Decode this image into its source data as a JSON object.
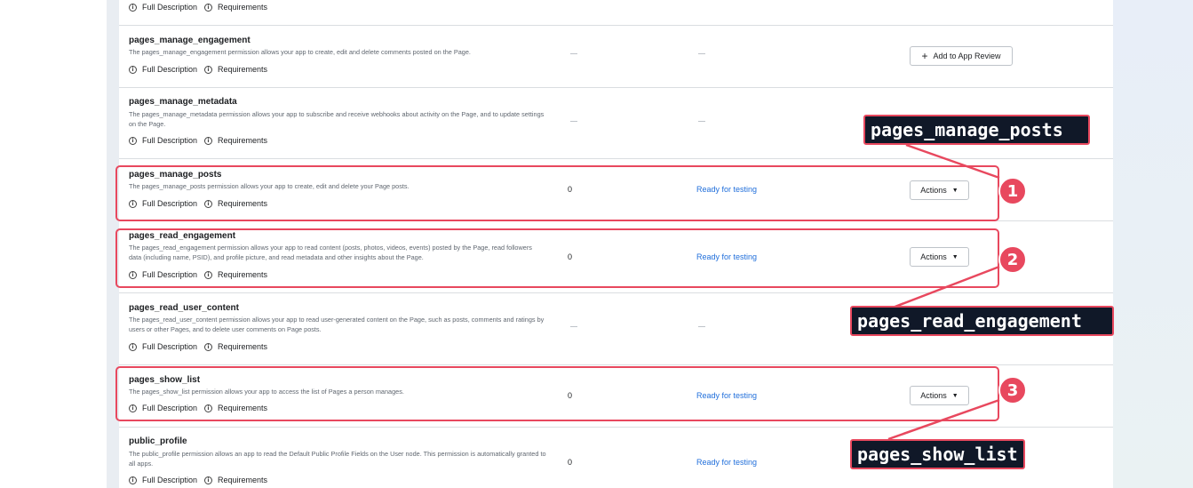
{
  "links": {
    "full_description": "Full Description",
    "requirements": "Requirements",
    "info_glyph": "i"
  },
  "rows": [
    {
      "name": "",
      "desc": ""
    },
    {
      "name": "pages_manage_engagement",
      "desc": "The pages_manage_engagement permission allows your app to create, edit and delete comments posted on the Page.",
      "button": "Add to App Review"
    },
    {
      "name": "pages_manage_metadata",
      "desc": "The pages_manage_metadata permission allows your app to subscribe and receive webhooks about activity on the Page, and to update settings on the Page."
    },
    {
      "name": "pages_manage_posts",
      "desc": "The pages_manage_posts permission allows your app to create, edit and delete your Page posts.",
      "count": "0",
      "status": "Ready for testing",
      "button": "Actions"
    },
    {
      "name": "pages_read_engagement",
      "desc": "The pages_read_engagement permission allows your app to read content (posts, photos, videos, events) posted by the Page, read followers data (including name, PSID), and profile picture, and read metadata and other insights about the Page.",
      "count": "0",
      "status": "Ready for testing",
      "button": "Actions"
    },
    {
      "name": "pages_read_user_content",
      "desc": "The pages_read_user_content permission allows your app to read user-generated content on the Page, such as posts, comments and ratings by users or other Pages, and to delete user comments on Page posts."
    },
    {
      "name": "pages_show_list",
      "desc": "The pages_show_list permission allows your app to access the list of Pages a person manages.",
      "count": "0",
      "status": "Ready for testing",
      "button": "Actions"
    },
    {
      "name": "public_profile",
      "desc": "The public_profile permission allows an app to read the Default Public Profile Fields on the User node. This permission is automatically granted to all apps.",
      "count": "0",
      "status": "Ready for testing"
    }
  ],
  "annotations": [
    {
      "label": "pages_manage_posts",
      "number": "1"
    },
    {
      "label": "pages_read_engagement",
      "number": "2"
    },
    {
      "label": "pages_show_list",
      "number": "3"
    }
  ],
  "colors": {
    "highlight": "#e8485e",
    "callout_bg": "#101828",
    "status_link": "#216fdb"
  }
}
